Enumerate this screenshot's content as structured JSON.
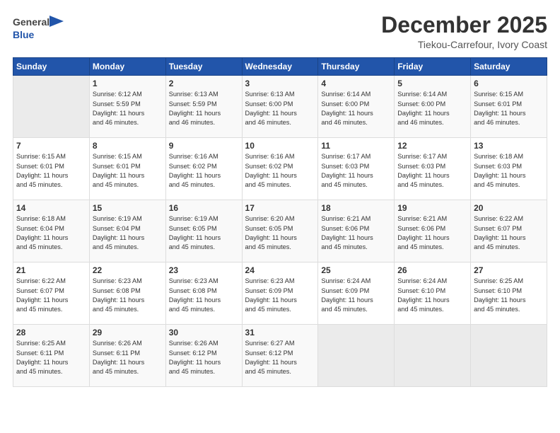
{
  "logo": {
    "line1": "General",
    "line2": "Blue"
  },
  "title": "December 2025",
  "location": "Tiekou-Carrefour, Ivory Coast",
  "days_of_week": [
    "Sunday",
    "Monday",
    "Tuesday",
    "Wednesday",
    "Thursday",
    "Friday",
    "Saturday"
  ],
  "weeks": [
    [
      {
        "day": "",
        "info": ""
      },
      {
        "day": "1",
        "info": "Sunrise: 6:12 AM\nSunset: 5:59 PM\nDaylight: 11 hours\nand 46 minutes."
      },
      {
        "day": "2",
        "info": "Sunrise: 6:13 AM\nSunset: 5:59 PM\nDaylight: 11 hours\nand 46 minutes."
      },
      {
        "day": "3",
        "info": "Sunrise: 6:13 AM\nSunset: 6:00 PM\nDaylight: 11 hours\nand 46 minutes."
      },
      {
        "day": "4",
        "info": "Sunrise: 6:14 AM\nSunset: 6:00 PM\nDaylight: 11 hours\nand 46 minutes."
      },
      {
        "day": "5",
        "info": "Sunrise: 6:14 AM\nSunset: 6:00 PM\nDaylight: 11 hours\nand 46 minutes."
      },
      {
        "day": "6",
        "info": "Sunrise: 6:15 AM\nSunset: 6:01 PM\nDaylight: 11 hours\nand 46 minutes."
      }
    ],
    [
      {
        "day": "7",
        "info": "Sunrise: 6:15 AM\nSunset: 6:01 PM\nDaylight: 11 hours\nand 45 minutes."
      },
      {
        "day": "8",
        "info": "Sunrise: 6:15 AM\nSunset: 6:01 PM\nDaylight: 11 hours\nand 45 minutes."
      },
      {
        "day": "9",
        "info": "Sunrise: 6:16 AM\nSunset: 6:02 PM\nDaylight: 11 hours\nand 45 minutes."
      },
      {
        "day": "10",
        "info": "Sunrise: 6:16 AM\nSunset: 6:02 PM\nDaylight: 11 hours\nand 45 minutes."
      },
      {
        "day": "11",
        "info": "Sunrise: 6:17 AM\nSunset: 6:03 PM\nDaylight: 11 hours\nand 45 minutes."
      },
      {
        "day": "12",
        "info": "Sunrise: 6:17 AM\nSunset: 6:03 PM\nDaylight: 11 hours\nand 45 minutes."
      },
      {
        "day": "13",
        "info": "Sunrise: 6:18 AM\nSunset: 6:03 PM\nDaylight: 11 hours\nand 45 minutes."
      }
    ],
    [
      {
        "day": "14",
        "info": "Sunrise: 6:18 AM\nSunset: 6:04 PM\nDaylight: 11 hours\nand 45 minutes."
      },
      {
        "day": "15",
        "info": "Sunrise: 6:19 AM\nSunset: 6:04 PM\nDaylight: 11 hours\nand 45 minutes."
      },
      {
        "day": "16",
        "info": "Sunrise: 6:19 AM\nSunset: 6:05 PM\nDaylight: 11 hours\nand 45 minutes."
      },
      {
        "day": "17",
        "info": "Sunrise: 6:20 AM\nSunset: 6:05 PM\nDaylight: 11 hours\nand 45 minutes."
      },
      {
        "day": "18",
        "info": "Sunrise: 6:21 AM\nSunset: 6:06 PM\nDaylight: 11 hours\nand 45 minutes."
      },
      {
        "day": "19",
        "info": "Sunrise: 6:21 AM\nSunset: 6:06 PM\nDaylight: 11 hours\nand 45 minutes."
      },
      {
        "day": "20",
        "info": "Sunrise: 6:22 AM\nSunset: 6:07 PM\nDaylight: 11 hours\nand 45 minutes."
      }
    ],
    [
      {
        "day": "21",
        "info": "Sunrise: 6:22 AM\nSunset: 6:07 PM\nDaylight: 11 hours\nand 45 minutes."
      },
      {
        "day": "22",
        "info": "Sunrise: 6:23 AM\nSunset: 6:08 PM\nDaylight: 11 hours\nand 45 minutes."
      },
      {
        "day": "23",
        "info": "Sunrise: 6:23 AM\nSunset: 6:08 PM\nDaylight: 11 hours\nand 45 minutes."
      },
      {
        "day": "24",
        "info": "Sunrise: 6:23 AM\nSunset: 6:09 PM\nDaylight: 11 hours\nand 45 minutes."
      },
      {
        "day": "25",
        "info": "Sunrise: 6:24 AM\nSunset: 6:09 PM\nDaylight: 11 hours\nand 45 minutes."
      },
      {
        "day": "26",
        "info": "Sunrise: 6:24 AM\nSunset: 6:10 PM\nDaylight: 11 hours\nand 45 minutes."
      },
      {
        "day": "27",
        "info": "Sunrise: 6:25 AM\nSunset: 6:10 PM\nDaylight: 11 hours\nand 45 minutes."
      }
    ],
    [
      {
        "day": "28",
        "info": "Sunrise: 6:25 AM\nSunset: 6:11 PM\nDaylight: 11 hours\nand 45 minutes."
      },
      {
        "day": "29",
        "info": "Sunrise: 6:26 AM\nSunset: 6:11 PM\nDaylight: 11 hours\nand 45 minutes."
      },
      {
        "day": "30",
        "info": "Sunrise: 6:26 AM\nSunset: 6:12 PM\nDaylight: 11 hours\nand 45 minutes."
      },
      {
        "day": "31",
        "info": "Sunrise: 6:27 AM\nSunset: 6:12 PM\nDaylight: 11 hours\nand 45 minutes."
      },
      {
        "day": "",
        "info": ""
      },
      {
        "day": "",
        "info": ""
      },
      {
        "day": "",
        "info": ""
      }
    ]
  ]
}
